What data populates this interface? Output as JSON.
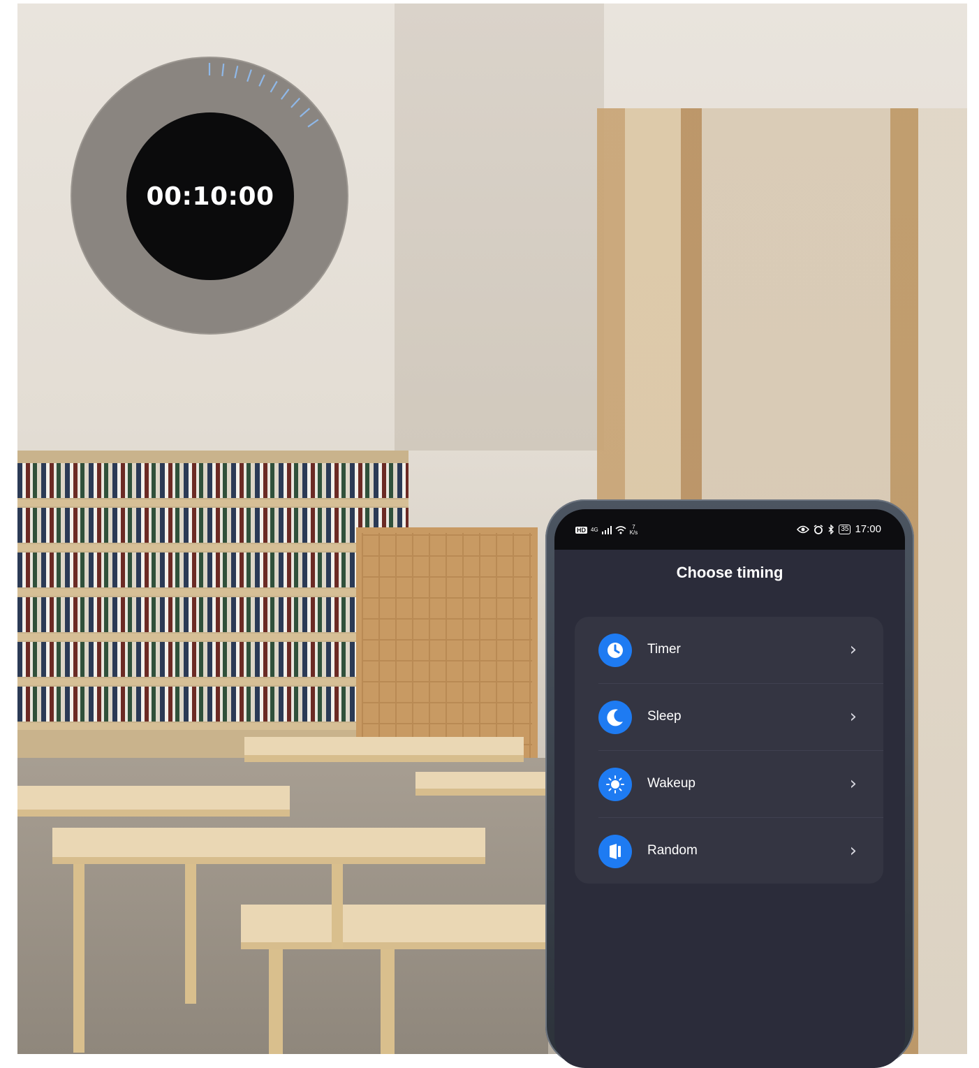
{
  "timer_overlay": {
    "time": "00:10:00",
    "progress_fraction": 0.17
  },
  "phone": {
    "status_bar": {
      "left": {
        "hd": "HD",
        "network": "4G",
        "speed_value": "7",
        "speed_unit": "K/s"
      },
      "right": {
        "battery": "35",
        "time": "17:00"
      },
      "icons": [
        "eye-icon",
        "alarm-icon",
        "bluetooth-icon",
        "battery-icon",
        "wifi-icon",
        "signal-icon"
      ]
    },
    "title": "Choose timing",
    "menu": [
      {
        "label": "Timer",
        "icon": "clock-icon"
      },
      {
        "label": "Sleep",
        "icon": "moon-icon"
      },
      {
        "label": "Wakeup",
        "icon": "sun-icon"
      },
      {
        "label": "Random",
        "icon": "random-icon"
      }
    ],
    "colors": {
      "accent": "#1e7bf2",
      "background": "#2b2c3a",
      "card": "#343542"
    }
  }
}
